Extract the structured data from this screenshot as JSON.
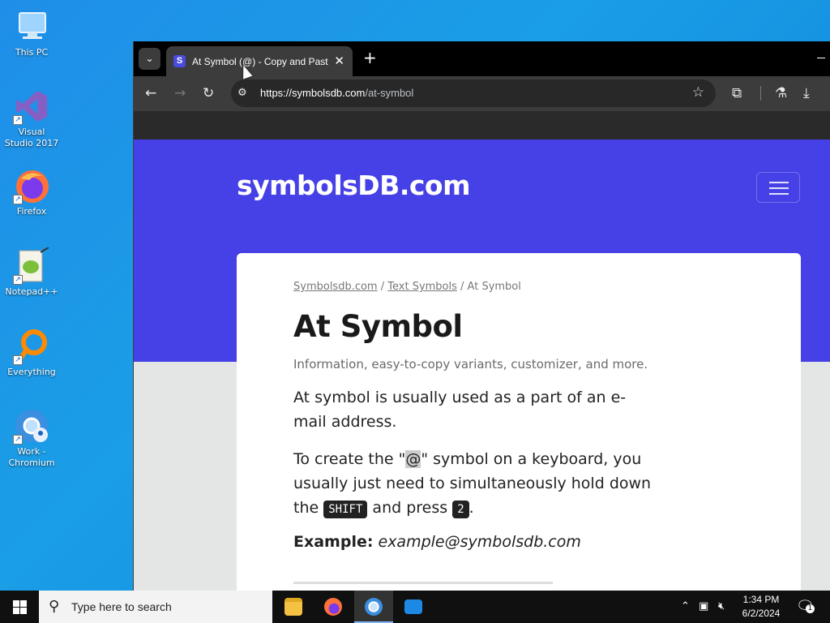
{
  "desktop": {
    "icons": [
      {
        "label": "This PC",
        "icon": "computer-icon"
      },
      {
        "label": "Visual Studio 2017",
        "icon": "visual-studio-icon"
      },
      {
        "label": "Firefox",
        "icon": "firefox-icon"
      },
      {
        "label": "Notepad++",
        "icon": "notepad-plus-plus-icon"
      },
      {
        "label": "Everything",
        "icon": "everything-search-icon"
      },
      {
        "label": "Work - Chromium",
        "icon": "chromium-icon"
      }
    ]
  },
  "browser": {
    "tab_title": "At Symbol (@) - Copy and Paste",
    "tab_favicon": "S",
    "url_host": "https://symbolsdb.com",
    "url_path": "/at-symbol"
  },
  "page": {
    "brand": "symbolsDB.com",
    "breadcrumb": {
      "home": "Symbolsdb.com",
      "sep1": " / ",
      "section": "Text Symbols",
      "sep2": " / ",
      "current": "At Symbol"
    },
    "title": "At Symbol",
    "subtitle": "Information, easy-to-copy variants, customizer, and more.",
    "intro": "At symbol is usually used as a part of an e-mail address.",
    "howto": {
      "part1": "To create the \"",
      "symbol": "@",
      "part2": "\" symbol on a keyboard, you usually just need to simultaneously hold down the ",
      "key1": "SHIFT",
      "part3": " and press ",
      "key2": "2",
      "part4": "."
    },
    "example_label": "Example:",
    "example_value": "example@symbolsdb.com"
  },
  "taskbar": {
    "search_placeholder": "Type here to search",
    "time": "1:34 PM",
    "date": "6/2/2024",
    "notification_count": "1"
  },
  "colors": {
    "hero": "#4641e6",
    "taskbar": "#101010",
    "desktop": "#1a9ee6"
  }
}
